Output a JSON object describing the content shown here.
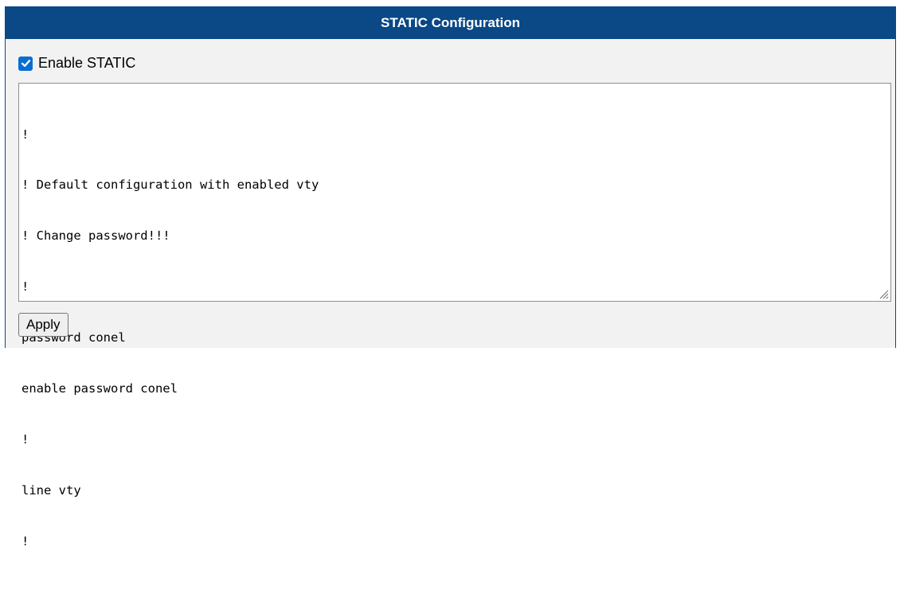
{
  "panel": {
    "title": "STATIC Configuration"
  },
  "enable": {
    "label": "Enable STATIC",
    "checked": true
  },
  "config": {
    "lines": [
      "!",
      "! Default configuration with enabled vty",
      "! Change password!!!",
      "!",
      "password conel",
      "enable password conel",
      "!",
      "line vty",
      "!"
    ]
  },
  "actions": {
    "apply_label": "Apply"
  },
  "colors": {
    "header_bg": "#0a4886",
    "checkbox_accent": "#0a6ed1",
    "panel_bg": "#f2f2f2"
  }
}
